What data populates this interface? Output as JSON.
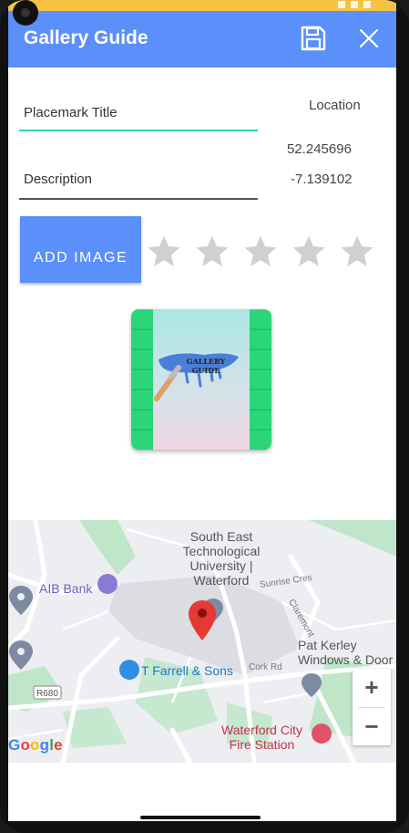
{
  "appbar": {
    "title": "Gallery Guide",
    "save_icon": "save-icon",
    "close_icon": "close-icon",
    "color": "#5b8ff9"
  },
  "form": {
    "title_label": "Placemark Title",
    "description_label": "Description",
    "location_label": "Location",
    "latitude": "52.245696",
    "longitude": "-7.139102",
    "add_image_label": "ADD IMAGE",
    "rating": 0,
    "rating_max": 5
  },
  "image": {
    "text_line1": "GALLERY",
    "text_line2": "GUIDE"
  },
  "map": {
    "places": {
      "setu_line1": "South East",
      "setu_line2": "Technological",
      "setu_line3": "University |",
      "setu_line4": "Waterford",
      "aib": "AIB Bank",
      "tfarrell": "T Farrell & Sons",
      "patkerley1": "Pat Kerley",
      "patkerley2": "Windows & Door",
      "firestation1": "Waterford City",
      "firestation2": "Fire Station"
    },
    "roads": {
      "sunrise": "Sunrise Cres",
      "claremont": "Claremont",
      "cork": "Cork Rd",
      "r680": "R680"
    },
    "zoom_in": "+",
    "zoom_out": "−",
    "attribution": "Google"
  },
  "colors": {
    "accent": "#5b8ff9",
    "underline_active": "#2ed6c0",
    "star_empty": "#d0d0d0",
    "status_bar": "#f6c244"
  }
}
